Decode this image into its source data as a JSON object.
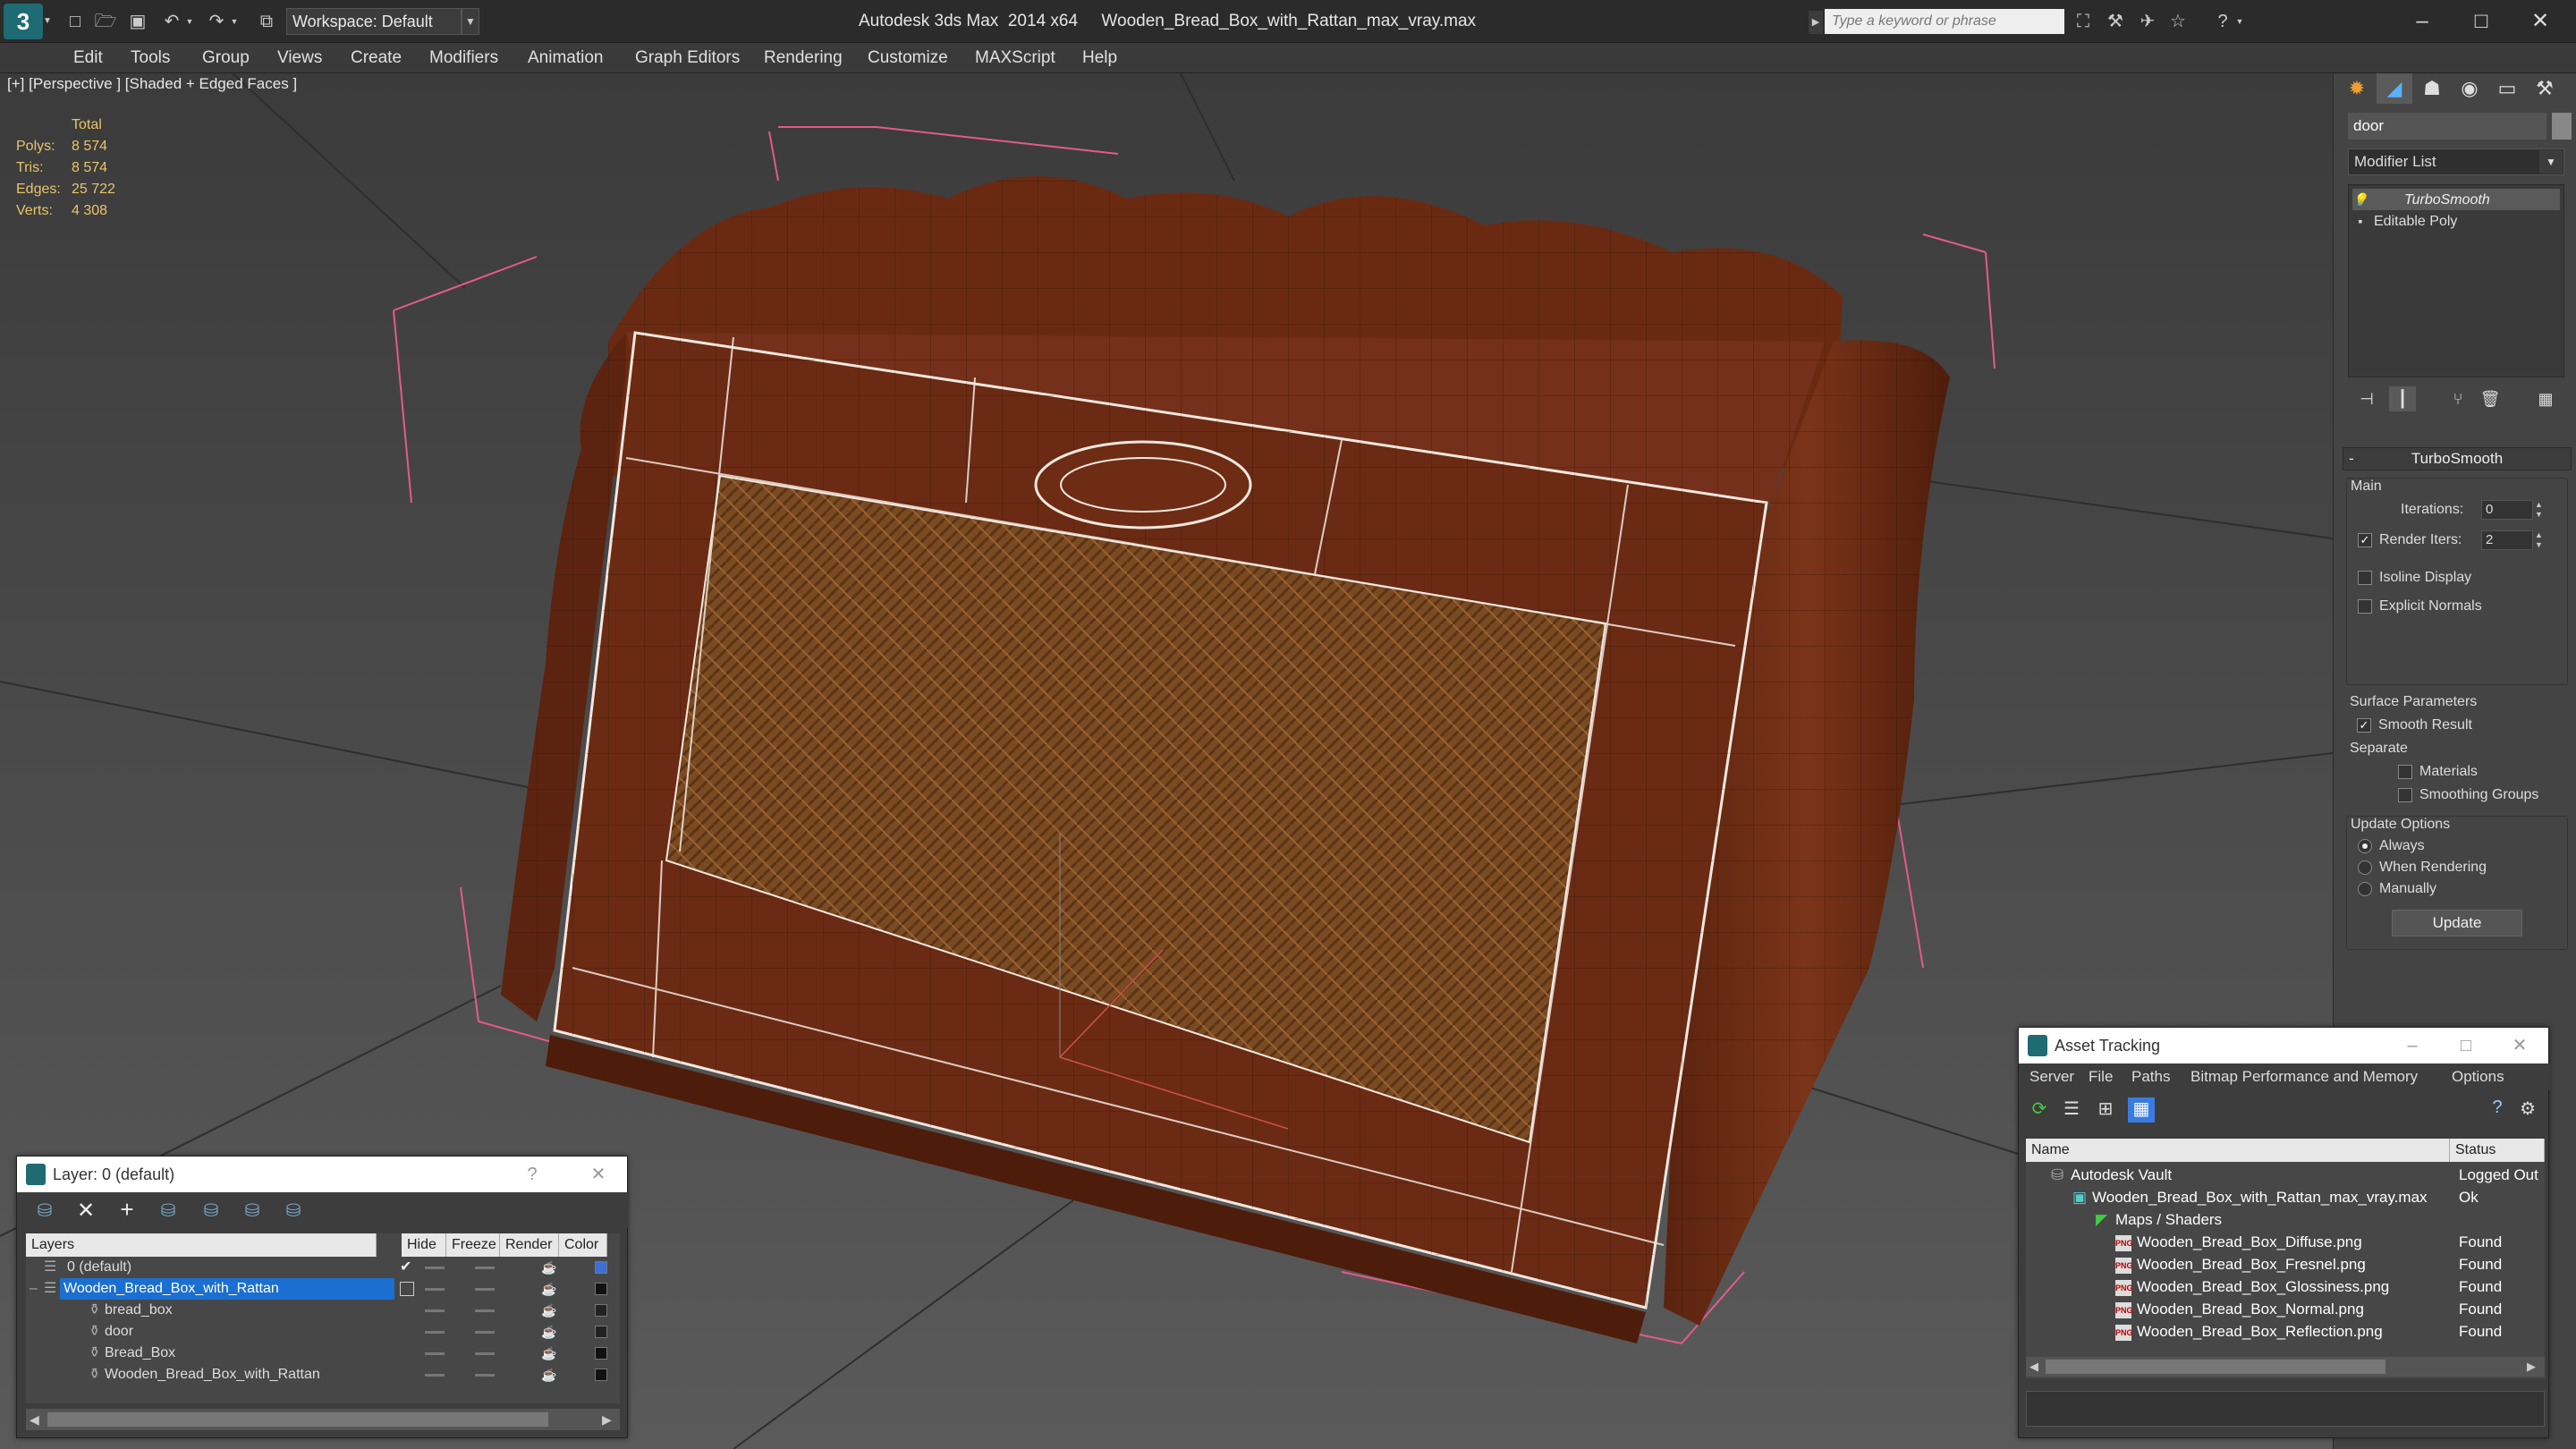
{
  "app": {
    "title": "Autodesk 3ds Max  2014 x64     Wooden_Bread_Box_with_Rattan_max_vray.max",
    "logo": "3",
    "workspace": "Workspace: Default",
    "search_placeholder": "Type a keyword or phrase"
  },
  "menu": [
    "Edit",
    "Tools",
    "Group",
    "Views",
    "Create",
    "Modifiers",
    "Animation",
    "Graph Editors",
    "Rendering",
    "Customize",
    "MAXScript",
    "Help"
  ],
  "viewport": {
    "label": "[+] [Perspective ] [Shaded + Edged Faces ]",
    "stats": {
      "header": "Total",
      "polys_label": "Polys:",
      "polys": "8 574",
      "tris_label": "Tris:",
      "tris": "8 574",
      "edges_label": "Edges:",
      "edges": "25 722",
      "verts_label": "Verts:",
      "verts": "4 308"
    }
  },
  "command_panel": {
    "object_name": "door",
    "modifier_list": "Modifier List",
    "stack": [
      "TurboSmooth",
      "Editable Poly"
    ],
    "rollout": "TurboSmooth",
    "main_label": "Main",
    "iterations_label": "Iterations:",
    "iterations": "0",
    "render_iters_label": "Render Iters:",
    "render_iters": "2",
    "isoline": "Isoline Display",
    "explicit_normals": "Explicit Normals",
    "surface_params": "Surface Parameters",
    "smooth_result": "Smooth Result",
    "separate": "Separate",
    "materials": "Materials",
    "smoothing_groups": "Smoothing Groups",
    "update_options": "Update Options",
    "always": "Always",
    "when_rendering": "When Rendering",
    "manually": "Manually",
    "update_button": "Update"
  },
  "layer_panel": {
    "title": "Layer: 0 (default)",
    "help": "?",
    "close": "✕",
    "columns": [
      "Layers",
      "Hide",
      "Freeze",
      "Render",
      "Color"
    ],
    "rows": [
      {
        "name": "0 (default)",
        "color": "#3d6fd9"
      },
      {
        "name": "Wooden_Bread_Box_with_Rattan",
        "color": "#111111"
      },
      {
        "name": "bread_box",
        "color": "#222222"
      },
      {
        "name": "door",
        "color": "#222222"
      },
      {
        "name": "Bread_Box",
        "color": "#111111"
      },
      {
        "name": "Wooden_Bread_Box_with_Rattan",
        "color": "#111111"
      }
    ]
  },
  "asset_panel": {
    "title": "Asset Tracking",
    "menu": [
      "Server",
      "File",
      "Paths",
      "Bitmap Performance and Memory",
      "Options"
    ],
    "columns": [
      "Name",
      "Status"
    ],
    "rows": [
      {
        "name": "Autodesk Vault",
        "status": "Logged Out"
      },
      {
        "name": "Wooden_Bread_Box_with_Rattan_max_vray.max",
        "status": "Ok"
      },
      {
        "name": "Maps / Shaders",
        "status": ""
      },
      {
        "name": "Wooden_Bread_Box_Diffuse.png",
        "status": "Found"
      },
      {
        "name": "Wooden_Bread_Box_Fresnel.png",
        "status": "Found"
      },
      {
        "name": "Wooden_Bread_Box_Glossiness.png",
        "status": "Found"
      },
      {
        "name": "Wooden_Bread_Box_Normal.png",
        "status": "Found"
      },
      {
        "name": "Wooden_Bread_Box_Reflection.png",
        "status": "Found"
      }
    ],
    "file_icon": "PNG"
  }
}
